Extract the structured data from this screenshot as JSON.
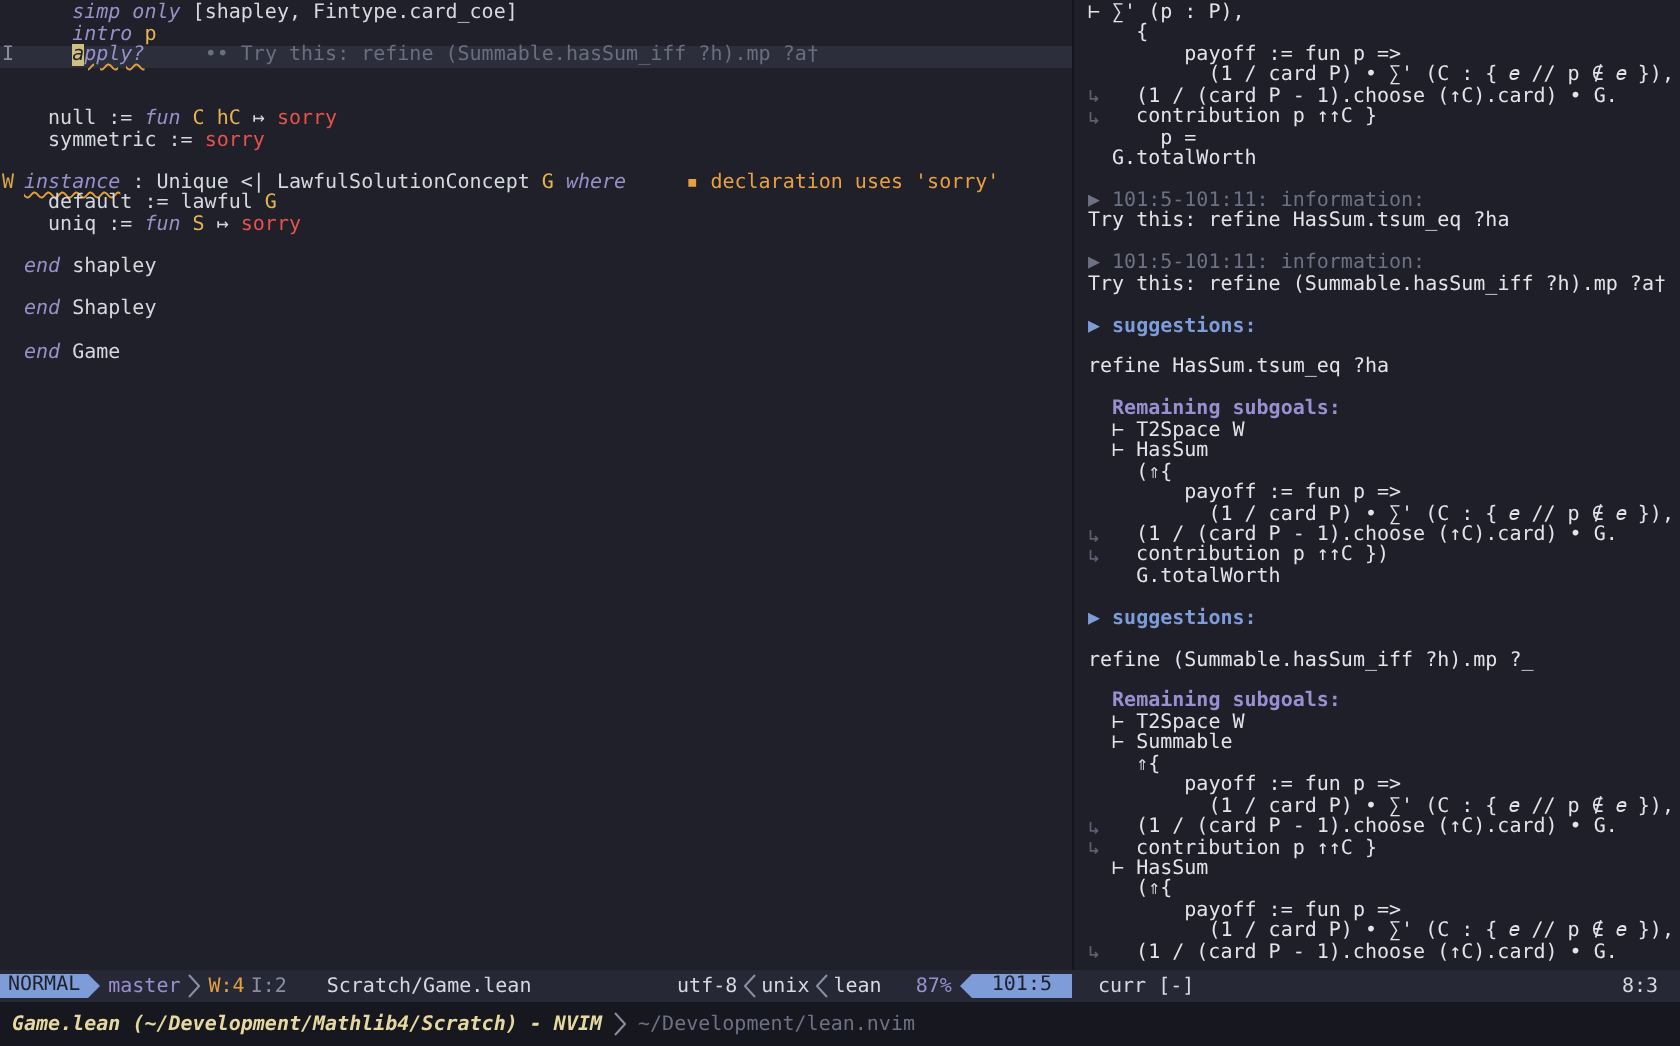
{
  "editor": {
    "lines": [
      {
        "cursor": false,
        "segments": [
          {
            "text": "    simp only",
            "kind": "keyword"
          },
          {
            "text": " [shapley, Fintype.card_coe]",
            "kind": "plain"
          }
        ]
      },
      {
        "cursor": false,
        "segments": [
          {
            "text": "    intro",
            "kind": "keyword"
          },
          {
            "text": " p",
            "kind": "variable"
          }
        ]
      },
      {
        "sign": "I",
        "cursor": true,
        "segments": [
          {
            "text": "    a",
            "kind": "cursor"
          },
          {
            "text": "pply?",
            "kind": "squiggle"
          },
          {
            "text": "     •• Try this: refine (Summable.hasSum_iff ?h).mp ?a†",
            "kind": "hint"
          }
        ]
      },
      {
        "cursor": false
      },
      {
        "cursor": false
      },
      {
        "cursor": false,
        "segments": [
          {
            "text": "  null := ",
            "kind": "plain"
          },
          {
            "text": "fun",
            "kind": "keyword"
          },
          {
            "text": " C hC",
            "kind": "variable"
          },
          {
            "text": " ↦ ",
            "kind": "plain"
          },
          {
            "text": "sorry",
            "kind": "error"
          }
        ]
      },
      {
        "cursor": false,
        "segments": [
          {
            "text": "  symmetric := ",
            "kind": "plain"
          },
          {
            "text": "sorry",
            "kind": "error"
          }
        ]
      },
      {
        "cursor": false
      },
      {
        "sign": "W",
        "cursor": false,
        "segments": [
          {
            "text": "instance",
            "kind": "squiggle"
          },
          {
            "text": " : Unique <| LawfulSolutionConcept ",
            "kind": "plain"
          },
          {
            "text": "G",
            "kind": "variable"
          },
          {
            "text": " where",
            "kind": "keyword"
          },
          {
            "text": "     ▪ declaration uses 'sorry'",
            "kind": "warning"
          }
        ]
      },
      {
        "cursor": false,
        "segments": [
          {
            "text": "  default := lawful ",
            "kind": "plain"
          },
          {
            "text": "G",
            "kind": "variable"
          }
        ]
      },
      {
        "cursor": false,
        "segments": [
          {
            "text": "  uniq := ",
            "kind": "plain"
          },
          {
            "text": "fun",
            "kind": "keyword"
          },
          {
            "text": " S",
            "kind": "variable"
          },
          {
            "text": " ↦ ",
            "kind": "plain"
          },
          {
            "text": "sorry",
            "kind": "error"
          }
        ]
      },
      {
        "cursor": false
      },
      {
        "cursor": false,
        "segments": [
          {
            "text": "end",
            "kind": "keyword"
          },
          {
            "text": " shapley",
            "kind": "plain"
          }
        ]
      },
      {
        "cursor": false
      },
      {
        "cursor": false,
        "segments": [
          {
            "text": "end",
            "kind": "keyword"
          },
          {
            "text": " Shapley",
            "kind": "plain"
          }
        ]
      },
      {
        "cursor": false
      },
      {
        "cursor": false,
        "segments": [
          {
            "text": "end",
            "kind": "keyword"
          },
          {
            "text": " Game",
            "kind": "plain"
          }
        ]
      }
    ]
  },
  "infoview": {
    "lines": [
      {
        "text": "⊢ ∑' (p : P),",
        "kind": "plain",
        "wrapped": false
      },
      {
        "text": "    {",
        "kind": "plain",
        "wrapped": false
      },
      {
        "text": "        payoff := fun p =>",
        "kind": "plain",
        "wrapped": false
      },
      {
        "text": "          (1 / card P) • ∑' (C : { 𝑒 // p ∉ 𝑒 }),",
        "kind": "plain",
        "wrapped": false
      },
      {
        "text": "   (1 / (card P - 1).choose (↑C).card) • G.",
        "kind": "plain",
        "wrapped": true
      },
      {
        "text": "   contribution p ↑↑C }",
        "kind": "plain",
        "wrapped": true
      },
      {
        "text": "      p =",
        "kind": "plain",
        "wrapped": false
      },
      {
        "text": "  G.totalWorth",
        "kind": "plain",
        "wrapped": false
      },
      {
        "wrapped": false
      },
      {
        "text": "▶ 101:5-101:11: information:",
        "kind": "info",
        "wrapped": false
      },
      {
        "text": "Try this: refine HasSum.tsum_eq ?ha",
        "kind": "plain",
        "wrapped": false
      },
      {
        "wrapped": false
      },
      {
        "text": "▶ 101:5-101:11: information:",
        "kind": "info",
        "wrapped": false
      },
      {
        "text": "Try this: refine (Summable.hasSum_iff ?h).mp ?a†",
        "kind": "plain",
        "wrapped": false
      },
      {
        "wrapped": false
      },
      {
        "text": "▶ suggestions:",
        "kind": "suggestions",
        "wrapped": false
      },
      {
        "wrapped": false
      },
      {
        "text": "refine HasSum.tsum_eq ?ha",
        "kind": "plain",
        "wrapped": false
      },
      {
        "wrapped": false
      },
      {
        "text": "  Remaining subgoals:",
        "kind": "heading",
        "wrapped": false
      },
      {
        "text": "  ⊢ T2Space W",
        "kind": "plain",
        "wrapped": false
      },
      {
        "text": "  ⊢ HasSum",
        "kind": "plain",
        "wrapped": false
      },
      {
        "text": "    (⇑{",
        "kind": "plain",
        "wrapped": false
      },
      {
        "text": "        payoff := fun p =>",
        "kind": "plain",
        "wrapped": false
      },
      {
        "text": "          (1 / card P) • ∑' (C : { 𝑒 // p ∉ 𝑒 }),",
        "kind": "plain",
        "wrapped": false
      },
      {
        "text": "   (1 / (card P - 1).choose (↑C).card) • G.",
        "kind": "plain",
        "wrapped": true
      },
      {
        "text": "   contribution p ↑↑C })",
        "kind": "plain",
        "wrapped": true
      },
      {
        "text": "    G.totalWorth",
        "kind": "plain",
        "wrapped": false
      },
      {
        "wrapped": false
      },
      {
        "text": "▶ suggestions:",
        "kind": "suggestions",
        "wrapped": false
      },
      {
        "wrapped": false
      },
      {
        "text": "refine (Summable.hasSum_iff ?h).mp ?_",
        "kind": "plain",
        "wrapped": false
      },
      {
        "wrapped": false
      },
      {
        "text": "  Remaining subgoals:",
        "kind": "heading",
        "wrapped": false
      },
      {
        "text": "  ⊢ T2Space W",
        "kind": "plain",
        "wrapped": false
      },
      {
        "text": "  ⊢ Summable",
        "kind": "plain",
        "wrapped": false
      },
      {
        "text": "    ⇑{",
        "kind": "plain",
        "wrapped": false
      },
      {
        "text": "        payoff := fun p =>",
        "kind": "plain",
        "wrapped": false
      },
      {
        "text": "          (1 / card P) • ∑' (C : { 𝑒 // p ∉ 𝑒 }),",
        "kind": "plain",
        "wrapped": false
      },
      {
        "text": "   (1 / (card P - 1).choose (↑C).card) • G.",
        "kind": "plain",
        "wrapped": true
      },
      {
        "text": "   contribution p ↑↑C }",
        "kind": "plain",
        "wrapped": true
      },
      {
        "text": "  ⊢ HasSum",
        "kind": "plain",
        "wrapped": false
      },
      {
        "text": "    (⇑{",
        "kind": "plain",
        "wrapped": false
      },
      {
        "text": "        payoff := fun p =>",
        "kind": "plain",
        "wrapped": false
      },
      {
        "text": "          (1 / card P) • ∑' (C : { 𝑒 // p ∉ 𝑒 }),",
        "kind": "plain",
        "wrapped": false
      },
      {
        "text": "   (1 / (card P - 1).choose (↑C).card) • G.",
        "kind": "plain",
        "wrapped": true
      }
    ]
  },
  "statusline": {
    "mode": "NORMAL",
    "branch": "master",
    "warnings": "W:4",
    "infos": "I:2",
    "file": "Scratch/Game.lean",
    "encoding": "utf-8",
    "format": "unix",
    "filetype": "lean",
    "percent": "87%",
    "position": "101:5"
  },
  "infoview_statusline": {
    "name": "curr [-]",
    "position": "8:3"
  },
  "title_bar": {
    "title": "Game.lean (~/Development/Mathlib4/Scratch) - NVIM",
    "path": "~/Development/lean.nvim"
  }
}
